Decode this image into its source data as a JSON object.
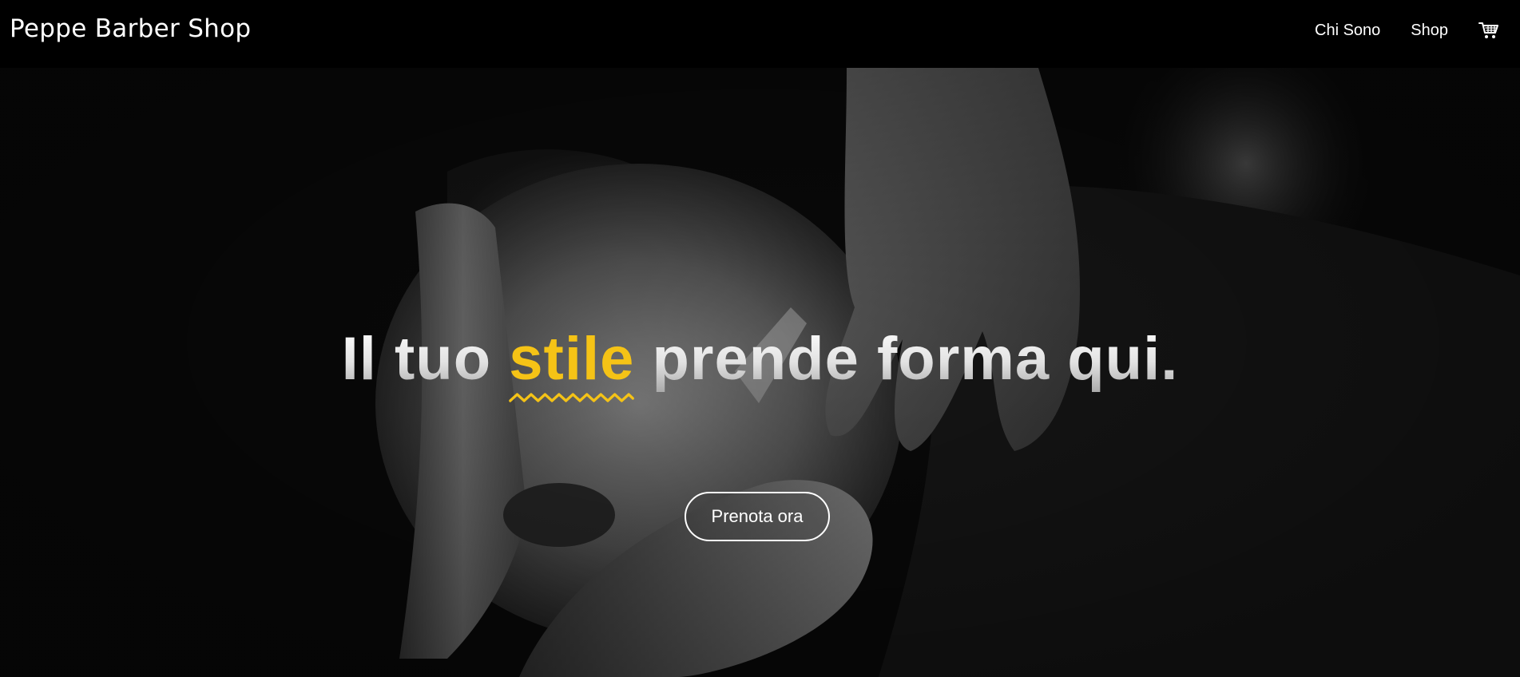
{
  "navbar": {
    "brand": "Peppe Barber Shop",
    "links": [
      "Chi Sono",
      "Shop"
    ],
    "cart_icon": "cart-icon"
  },
  "hero": {
    "headline_before": "Il tuo ",
    "headline_accent": "stile",
    "headline_after": " prende forma qui.",
    "cta_label": "Prenota ora",
    "image": "black-and-white photo of a barber shaving a customer with a straight razor"
  },
  "colors": {
    "navbar_background": "#000000",
    "accent": "#f5c316",
    "text": "#ffffff"
  }
}
